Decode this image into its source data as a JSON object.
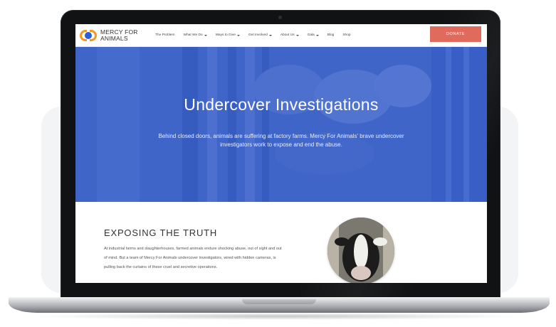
{
  "nav": {
    "logo_line1": "MERCY FOR",
    "logo_line2": "ANIMALS",
    "items": [
      {
        "label": "The Problem",
        "dropdown": false
      },
      {
        "label": "What We Do",
        "dropdown": true
      },
      {
        "label": "Ways to Give",
        "dropdown": true
      },
      {
        "label": "Get Involved",
        "dropdown": true
      },
      {
        "label": "About Us",
        "dropdown": true
      },
      {
        "label": "Gala",
        "dropdown": true
      },
      {
        "label": "Blog",
        "dropdown": false
      },
      {
        "label": "Shop",
        "dropdown": false
      }
    ],
    "donate_label": "DONATE"
  },
  "hero": {
    "title": "Undercover Investigations",
    "subtitle": "Behind closed doors, animals are suffering at factory farms. Mercy For Animals' brave undercover investigators work to expose and end the abuse."
  },
  "section": {
    "heading": "EXPOSING THE TRUTH",
    "body": "At industrial farms and slaughterhouses, farmed animals endure shocking abuse, out of sight and out of mind. But a team of Mercy For Animals undercover investigators, wired with hidden cameras, is pulling back the curtains of these cruel and secretive operations."
  },
  "colors": {
    "accent": "#e06a5c",
    "hero_blue": "#3f66c9",
    "logo_orange": "#f29a1f",
    "logo_blue": "#2c5fd6"
  },
  "icons": {
    "logo": "mercy-for-animals-logo",
    "dropdown": "chevron-down-icon",
    "camera": "webcam-dot"
  }
}
